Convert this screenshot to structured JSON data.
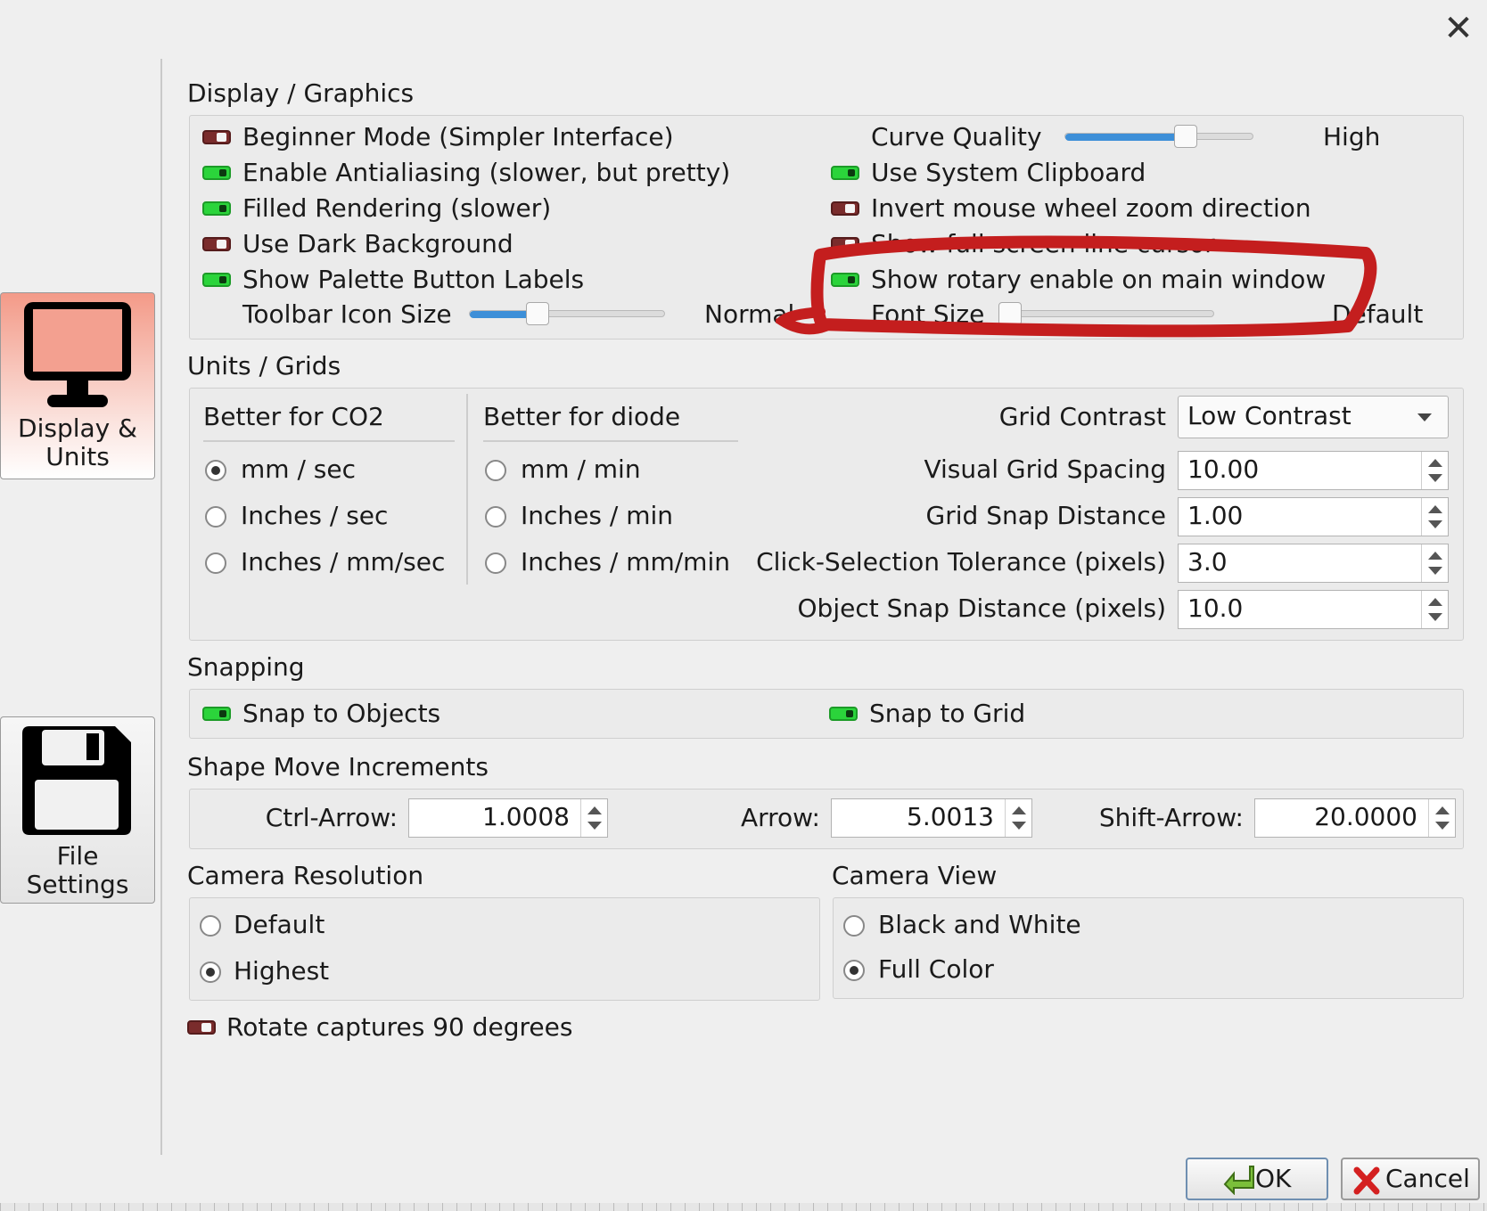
{
  "window": {
    "close_glyph": "✕"
  },
  "sidebar": {
    "items": [
      {
        "label": "Display &\nUnits",
        "icon": "monitor-icon",
        "selected": true
      },
      {
        "label": "File\nSettings",
        "icon": "floppy-disk-icon",
        "selected": false
      }
    ]
  },
  "display": {
    "title": "Display / Graphics",
    "left_toggles": [
      {
        "label": "Beginner Mode (Simpler Interface)",
        "on": false
      },
      {
        "label": "Enable Antialiasing (slower, but pretty)",
        "on": true
      },
      {
        "label": "Filled Rendering (slower)",
        "on": true
      },
      {
        "label": "Use Dark Background",
        "on": false
      },
      {
        "label": "Show Palette Button Labels",
        "on": true
      }
    ],
    "toolbar_icon_size": {
      "label": "Toolbar Icon Size",
      "value_text": "Normal",
      "level": 0.35
    },
    "curve_quality": {
      "label": "Curve Quality",
      "value_text": "High",
      "level": 0.64
    },
    "right_toggles": [
      {
        "label": "Use System Clipboard",
        "on": true
      },
      {
        "label": "Invert mouse wheel zoom direction",
        "on": false
      },
      {
        "label": "Show full screen line cursor",
        "on": false
      },
      {
        "label": "Show rotary enable on main window",
        "on": true
      }
    ],
    "font_size": {
      "label": "Font Size",
      "value_text": "Default",
      "level": 0.0
    }
  },
  "units": {
    "title": "Units / Grids",
    "co2": {
      "title": "Better for CO2",
      "options": [
        {
          "label": "mm / sec",
          "selected": true
        },
        {
          "label": "Inches / sec",
          "selected": false
        },
        {
          "label": "Inches / mm/sec",
          "selected": false
        }
      ]
    },
    "diode": {
      "title": "Better for diode",
      "options": [
        {
          "label": "mm / min",
          "selected": false
        },
        {
          "label": "Inches / min",
          "selected": false
        },
        {
          "label": "Inches / mm/min",
          "selected": false
        }
      ]
    },
    "grid_contrast": {
      "label": "Grid Contrast",
      "value": "Low Contrast"
    },
    "fields": [
      {
        "label": "Visual Grid Spacing",
        "value": "10.00"
      },
      {
        "label": "Grid Snap Distance",
        "value": "1.00"
      },
      {
        "label": "Click-Selection Tolerance (pixels)",
        "value": "3.0"
      },
      {
        "label": "Object Snap Distance (pixels)",
        "value": "10.0"
      }
    ]
  },
  "snapping": {
    "title": "Snapping",
    "snap_objects": {
      "label": "Snap to Objects",
      "on": true
    },
    "snap_grid": {
      "label": "Snap to Grid",
      "on": true
    }
  },
  "increments": {
    "title": "Shape Move Increments",
    "ctrl": {
      "label": "Ctrl-Arrow:",
      "value": "1.0008"
    },
    "arrow": {
      "label": "Arrow:",
      "value": "5.0013"
    },
    "shift": {
      "label": "Shift-Arrow:",
      "value": "20.0000"
    }
  },
  "camera_resolution": {
    "title": "Camera Resolution",
    "options": [
      {
        "label": "Default",
        "selected": false
      },
      {
        "label": "Highest",
        "selected": true
      }
    ]
  },
  "camera_view": {
    "title": "Camera View",
    "options": [
      {
        "label": "Black and White",
        "selected": false
      },
      {
        "label": "Full Color",
        "selected": true
      }
    ]
  },
  "rotate_captures": {
    "label": "Rotate captures 90 degrees",
    "on": false
  },
  "buttons": {
    "ok": "OK",
    "cancel": "Cancel"
  },
  "colors": {
    "annotation": "#c41e1e",
    "toggle_on": "#2bd43b",
    "toggle_off": "#7a2c2c",
    "slider": "#3d8fd8"
  }
}
